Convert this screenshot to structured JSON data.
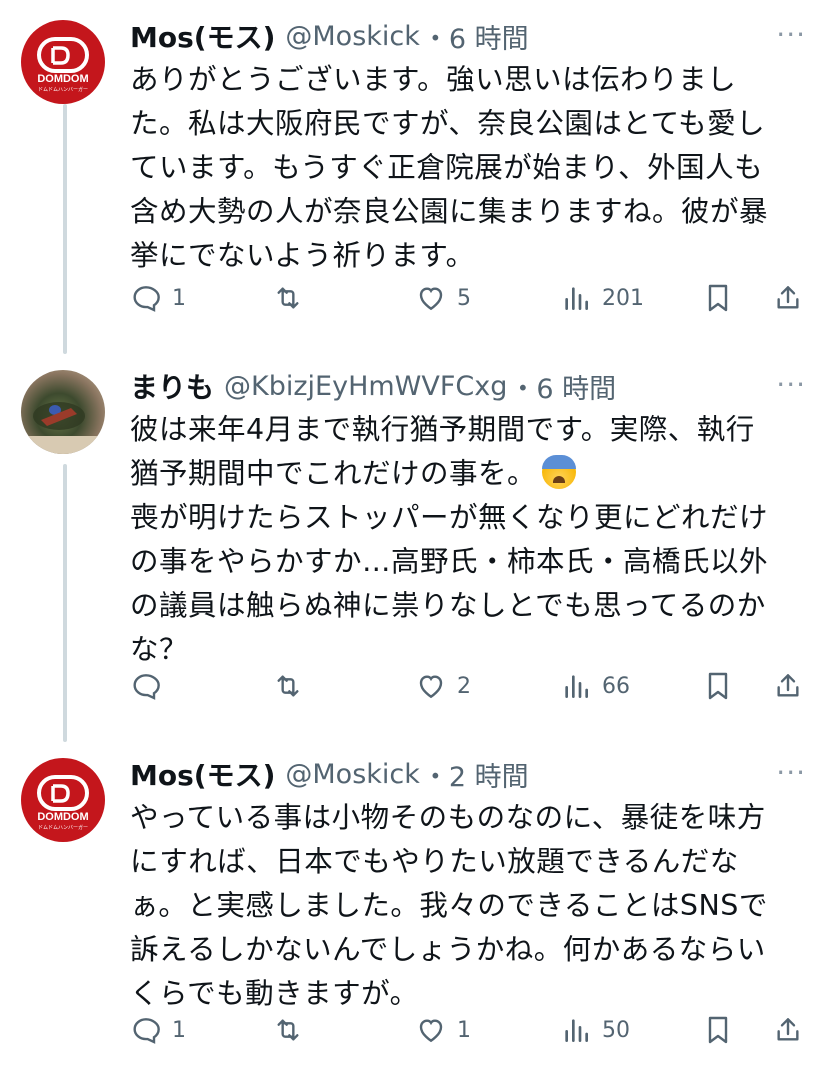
{
  "tweets": [
    {
      "name": "Mos(モス)",
      "handle": "@Moskick",
      "time": "・6 時間",
      "avatar_text": "DOMDOM",
      "avatar_subtext": "ドムドムハンバーガー",
      "text": "ありがとうございます。強い思いは伝わりまし\nた。私は大阪府民ですが、奈良公園はとても愛し\nています。もうすぐ正倉院展が始まり、外国人も\n含め大勢の人が奈良公園に集まりますね。彼が暴\n挙にでないよう祈ります。",
      "replies": "1",
      "retweets": "",
      "likes": "5",
      "views": "201"
    },
    {
      "name": "まりも",
      "handle": "@KbizjEyHmWVFCxg",
      "time": "・6 時間",
      "text_before_emoji": "彼は来年4月まで執行猶予期間です。実際、執行\n猶予期間中でこれだけの事を。",
      "emoji": "anxious-sweat-face",
      "text_after_emoji": "\n喪が明けたらストッパーが無くなり更にどれだけ\nの事をやらかすか…高野氏・柿本氏・高橋氏以外\nの議員は触らぬ神に祟りなしとでも思ってるのか\nな？",
      "replies": "",
      "retweets": "",
      "likes": "2",
      "views": "66"
    },
    {
      "name": "Mos(モス)",
      "handle": "@Moskick",
      "time": "・2 時間",
      "avatar_text": "DOMDOM",
      "avatar_subtext": "ドムドムハンバーガー",
      "text": "やっている事は小物そのものなのに、暴徒を味方\nにすれば、日本でもやりたい放題できるんだな\nぁ。と実感しました。我々のできることはSNSで\n訴えるしかないんでしょうかね。何かあるならい\nくらでも動きますが。",
      "replies": "1",
      "retweets": "",
      "likes": "1",
      "views": "50"
    }
  ],
  "more_label": "···",
  "colors": {
    "text": "#0f1419",
    "muted": "#536471",
    "brand_red": "#c4161c",
    "thread_line": "#cfd9de"
  }
}
